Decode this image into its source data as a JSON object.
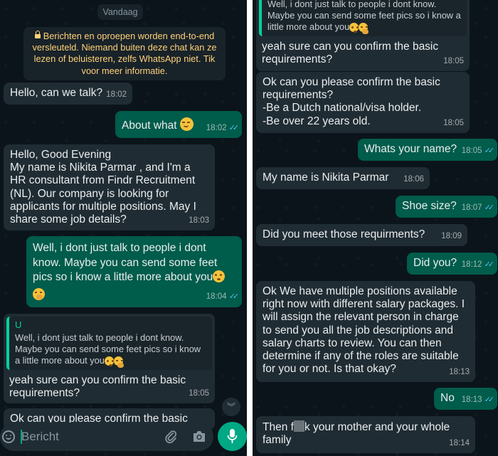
{
  "left_chat": {
    "date_chip": "Vandaag",
    "encryption_notice": "Berichten en oproepen worden end-to-end versleuteld. Niemand buiten deze chat kan ze lezen of beluisteren, zelfs WhatsApp niet. Tik voor meer informatie.",
    "messages": [
      {
        "dir": "in",
        "text": "Hello, can we talk?",
        "time": "18:02"
      },
      {
        "dir": "out",
        "text": "About what",
        "time": "18:02"
      },
      {
        "dir": "in",
        "text": "Hello, Good Evening\nMy name is Nikita Parmar , and I'm a HR consultant from Findr Recruitment (NL). Our company is looking for applicants for multiple positions. May I share some job details?",
        "time": "18:03"
      },
      {
        "dir": "out",
        "text": "Well, i dont just talk to people i dont know. Maybe you can send some feet pics so i know a little more about you",
        "time": "18:04"
      },
      {
        "dir": "in",
        "quote_author": "U",
        "quote_text": "Well, i dont just talk to people i dont know. Maybe you can send some feet pics so i know a little more about you",
        "text": "yeah sure can you confirm the basic requirements?",
        "time": "18:05"
      },
      {
        "dir": "in",
        "text": "Ok can you please confirm the basic"
      }
    ],
    "composer": {
      "placeholder": "Bericht"
    }
  },
  "right_chat": {
    "messages": [
      {
        "dir": "in",
        "quote_text": "Well, i dont just talk to people i dont know. Maybe you can send some feet pics so i know a little more about you",
        "text": "yeah sure can you confirm the basic requirements?",
        "time": "18:05"
      },
      {
        "dir": "in",
        "text": "Ok can you please confirm the basic requirements?\n-Be a Dutch national/visa holder.\n-Be over 22 years old.",
        "time": "18:05"
      },
      {
        "dir": "out",
        "text": "Whats your name?",
        "time": "18:05"
      },
      {
        "dir": "in",
        "text": "My name is Nikita Parmar",
        "time": "18:06"
      },
      {
        "dir": "out",
        "text": "Shoe size?",
        "time": "18:07"
      },
      {
        "dir": "in",
        "text": "Did you meet those requirments?",
        "time": "18:09"
      },
      {
        "dir": "out",
        "text": "Did you?",
        "time": "18:12"
      },
      {
        "dir": "in",
        "text": "Ok We have multiple positions available right now with different salary packages. I will assign the relevant person in charge to send you all the job descriptions and salary charts to review. You can then determine if any of the roles are suitable for you or not. Is that okay?",
        "time": "18:13"
      },
      {
        "dir": "out",
        "text": "No",
        "time": "18:13"
      },
      {
        "dir": "in",
        "text_before": "Then f",
        "text_after": "k your mother and your whole family",
        "time": "18:14"
      }
    ]
  },
  "colors": {
    "incoming": "#202c33",
    "outgoing": "#005c4b",
    "background": "#0b141a",
    "read_ticks": "#53bdeb",
    "accent": "#00a884"
  },
  "icons": [
    "lock-icon",
    "double-check-icon",
    "chevron-down-icon",
    "emoji-icon",
    "paperclip-icon",
    "camera-icon",
    "microphone-icon"
  ]
}
